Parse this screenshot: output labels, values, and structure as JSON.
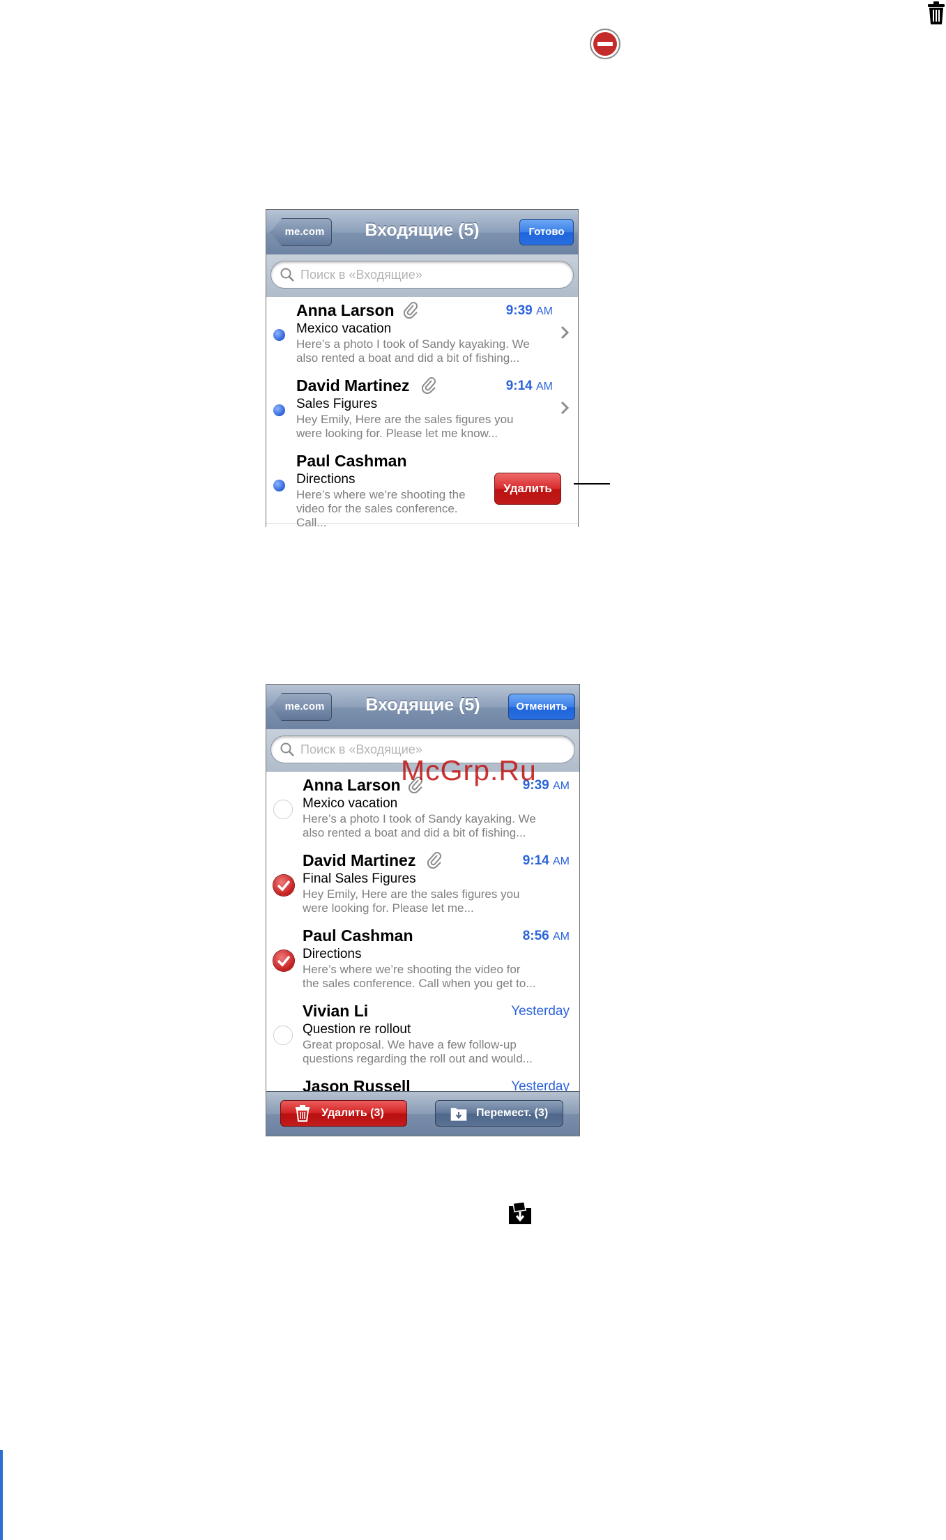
{
  "watermark": "McGrp.Ru",
  "screen1": {
    "back": "me.com",
    "title": "Входящие (5)",
    "right_button": "Готово",
    "search_placeholder": "Поиск в «Входящие»",
    "messages": [
      {
        "from": "Anna Larson",
        "attachment": true,
        "time": "9:39",
        "ampm": "AM",
        "subject": "Mexico vacation",
        "preview1": "Here’s a photo I took of Sandy kayaking. We",
        "preview2": "also rented a boat and did a bit of fishing..."
      },
      {
        "from": "David Martinez",
        "attachment": true,
        "time": "9:14",
        "ampm": "AM",
        "subject": "Sales Figures",
        "preview1": "Hey Emily, Here are the sales figures you",
        "preview2": "were looking for. Please let me know..."
      },
      {
        "from": "Paul Cashman",
        "attachment": false,
        "subject": "Directions",
        "preview1": "Here’s where we’re shooting the",
        "preview2": "video for the sales conference. Call..."
      }
    ],
    "delete_button": "Удалить"
  },
  "screen2": {
    "back": "me.com",
    "title": "Входящие (5)",
    "right_button": "Отменить",
    "search_placeholder": "Поиск в «Входящие»",
    "messages": [
      {
        "from": "Anna Larson",
        "attachment": true,
        "time": "9:39",
        "ampm": "AM",
        "subject": "Mexico vacation",
        "preview1": "Here’s a photo I took of Sandy kayaking. We",
        "preview2": "also rented a boat and did a bit of fishing...",
        "checked": false
      },
      {
        "from": "David Martinez",
        "attachment": true,
        "time": "9:14",
        "ampm": "AM",
        "subject": "Final Sales Figures",
        "preview1": "Hey Emily, Here are the sales figures you",
        "preview2": "were looking for. Please let me...",
        "checked": true
      },
      {
        "from": "Paul Cashman",
        "attachment": false,
        "time": "8:56",
        "ampm": "AM",
        "subject": "Directions",
        "preview1": "Here’s where we’re shooting the video for",
        "preview2": "the sales conference. Call when you get to...",
        "checked": true
      },
      {
        "from": "Vivian Li",
        "attachment": false,
        "time": "Yesterday",
        "subject": "Question re rollout",
        "preview1": "Great proposal. We have a few follow-up",
        "preview2": "questions regarding the roll out and would...",
        "checked": false
      },
      {
        "from": "Jason Russell",
        "time": "Yesterday"
      }
    ],
    "toolbar": {
      "delete": "Удалить (3)",
      "move": "Перемест. (3)"
    }
  },
  "icons": [
    "trash-icon",
    "minus-circle-icon",
    "move-folder-icon",
    "paperclip-icon",
    "search-icon",
    "chevron-right-icon",
    "checkmark-icon"
  ]
}
